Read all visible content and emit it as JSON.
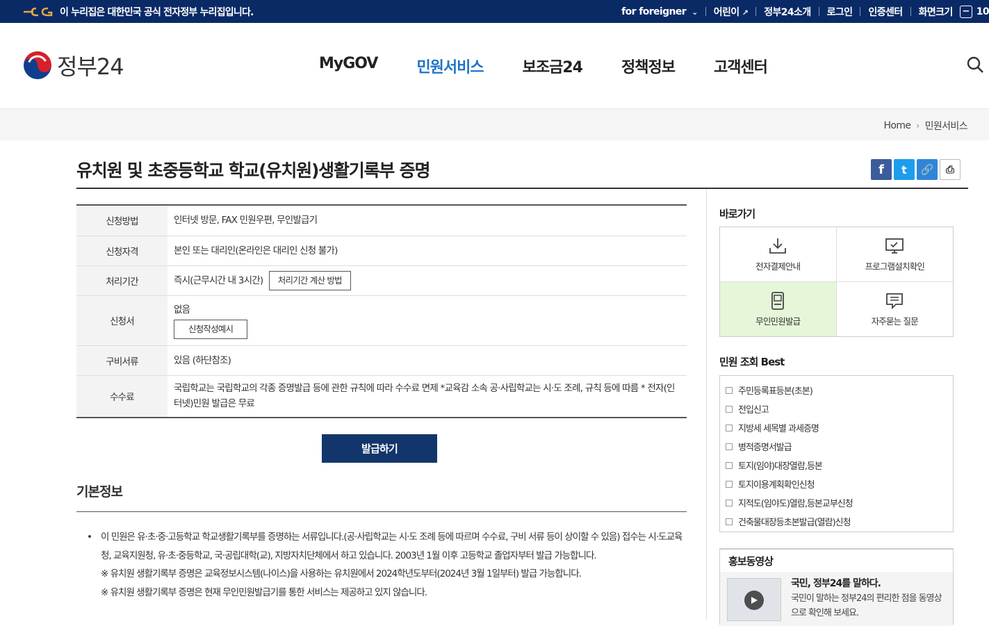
{
  "topbar": {
    "notice": "이 누리집은 대한민국 공식 전자정부 누리집입니다.",
    "links": [
      {
        "label": "for foreigner"
      },
      {
        "label": "어린이"
      },
      {
        "label": "정부24소개"
      },
      {
        "label": "로그인"
      },
      {
        "label": "인증센터"
      },
      {
        "label": "화면크기"
      }
    ],
    "zoom_value": "10",
    "zoom_out_symbol": "−"
  },
  "header": {
    "logo_text": "정부24",
    "nav": [
      "MyGOV",
      "민원서비스",
      "보조금24",
      "정책정보",
      "고객센터"
    ],
    "active_nav": "민원서비스"
  },
  "breadcrumb": {
    "home": "Home",
    "current": "민원서비스"
  },
  "page": {
    "title": "유치원 및 초중등학교 학교(유치원)생활기록부 증명"
  },
  "share": {
    "facebook": "f",
    "twitter": "t",
    "link": "🔗",
    "print": "⎙"
  },
  "info_table": {
    "rows": [
      {
        "label": "신청방법",
        "value": "인터넷 방문, FAX 민원우편, 무인발급기"
      },
      {
        "label": "신청자격",
        "value": "본인 또는 대리인(온라인은 대리인 신청 불가)"
      },
      {
        "label": "처리기간",
        "value": "즉시(근무시간 내 3시간)",
        "button": "처리기간 계산 방법"
      },
      {
        "label": "신청서",
        "value": "없음",
        "button": "신청작성예시"
      },
      {
        "label": "구비서류",
        "value": "있음 (하단참조)"
      },
      {
        "label": "수수료",
        "value": "국립학교는 국립학교의 각종 증명발급 등에 관한 규칙에 따라 수수료 면제 *교육감 소속 공·사립학교는 시·도 조례, 규칙 등에 따름 * 전자(인터넷)민원 발급은 무료"
      }
    ]
  },
  "issue_button": "발급하기",
  "basic_info": {
    "title": "기본정보",
    "bullet": "이 민원은 유·초·중·고등학교 학교생활기록부를 증명하는 서류입니다.(공·사립학교는 시·도 조례 등에 따르며 수수료, 구비 서류 등이 상이할 수 있음) 접수는 시·도교육청, 교육지원청, 유·초·중등학교, 국·공립대학(교), 지방자치단체에서 하고 있습니다. 2003년 1월 이후 고등학교 졸업자부터 발급 가능합니다.",
    "note1": "※ 유치원 생활기록부 증명은 교육정보시스템(나이스)을 사용하는 유치원에서 2024학년도부터(2024년 3월 1일부터) 발급 가능합니다.",
    "note2": "※ 유치원 생활기록부 증명은 현재 무인민원발급기를 통한 서비스는 제공하고 있지 않습니다."
  },
  "sidebar": {
    "quick_title": "바로가기",
    "quick_items": [
      {
        "label": "전자결제안내",
        "icon": "download-icon"
      },
      {
        "label": "프로그램설치확인",
        "icon": "monitor-icon"
      },
      {
        "label": "무인민원발급",
        "icon": "kiosk-icon"
      },
      {
        "label": "자주묻는 질문",
        "icon": "chat-icon"
      }
    ],
    "best_title": "민원 조회 Best",
    "best_items": [
      "주민등록표등본(초본)",
      "전입신고",
      "지방세 세목별 과세증명",
      "병적증명서발급",
      "토지(임야)대장열람,등본",
      "토지이용계획확인신청",
      "지적도(임야도)열람,등본교부신청",
      "건축물대장등초본발급(열람)신청"
    ],
    "promo_title": "홍보동영상",
    "promo_headline": "국민, 정부24를 말하다.",
    "promo_desc": "국민이 말하는 정부24의 편리한 점을 동영상으로 확인해 보세요."
  },
  "colors": {
    "topbar_bg": "#0a2a66",
    "active_nav": "#1d73c9",
    "issue_button_bg": "#12366b",
    "highlight_green": "#e5f7d8"
  }
}
